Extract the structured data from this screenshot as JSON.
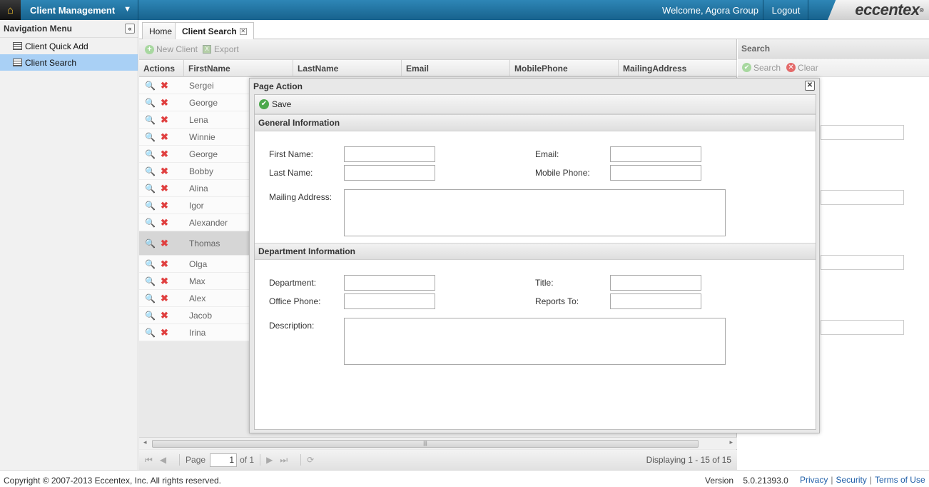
{
  "header": {
    "app_menu_label": "Client Management",
    "welcome": "Welcome, Agora Group",
    "logout": "Logout",
    "logo": "eccentex",
    "logo_mark": "®"
  },
  "nav": {
    "title": "Navigation Menu",
    "items": [
      {
        "label": "Client Quick Add",
        "selected": false
      },
      {
        "label": "Client Search",
        "selected": true
      }
    ]
  },
  "tabs": [
    {
      "label": "Home"
    },
    {
      "label": "Client Search",
      "active": true
    }
  ],
  "grid": {
    "toolbar": {
      "new_client": "New Client",
      "export": "Export"
    },
    "columns": [
      "Actions",
      "FirstName",
      "LastName",
      "Email",
      "MobilePhone",
      "MailingAddress"
    ],
    "rows": [
      "Sergei",
      "George",
      "Lena",
      "Winnie",
      "George",
      "Bobby",
      "Alina",
      "Igor",
      "Alexander",
      "Thomas",
      "Olga",
      "Max",
      "Alex",
      "Jacob",
      "Irina"
    ],
    "pager": {
      "page_label": "Page",
      "page_value": "1",
      "of_label": "of 1",
      "displaying": "Displaying 1 - 15 of 15"
    }
  },
  "search_panel": {
    "title": "Search",
    "search_label": "Search",
    "clear_label": "Clear"
  },
  "modal": {
    "title": "Page Action",
    "save_label": "Save",
    "general_section": "General Information",
    "department_section": "Department Information",
    "labels": {
      "first_name": "First Name:",
      "last_name": "Last Name:",
      "email": "Email:",
      "mobile_phone": "Mobile Phone:",
      "mailing_address": "Mailing Address:",
      "department": "Department:",
      "office_phone": "Office Phone:",
      "title": "Title:",
      "reports_to": "Reports To:",
      "description": "Description:"
    }
  },
  "footer": {
    "copyright": "Copyright © 2007-2013 Eccentex, Inc. All rights reserved.",
    "version_label": "Version",
    "version_value": "5.0.21393.0",
    "links": [
      "Privacy",
      "Security",
      "Terms of Use"
    ]
  },
  "colors": {
    "topbar": "#17628d",
    "selected_nav": "#a9d0f5",
    "delete_icon": "#e04040"
  }
}
